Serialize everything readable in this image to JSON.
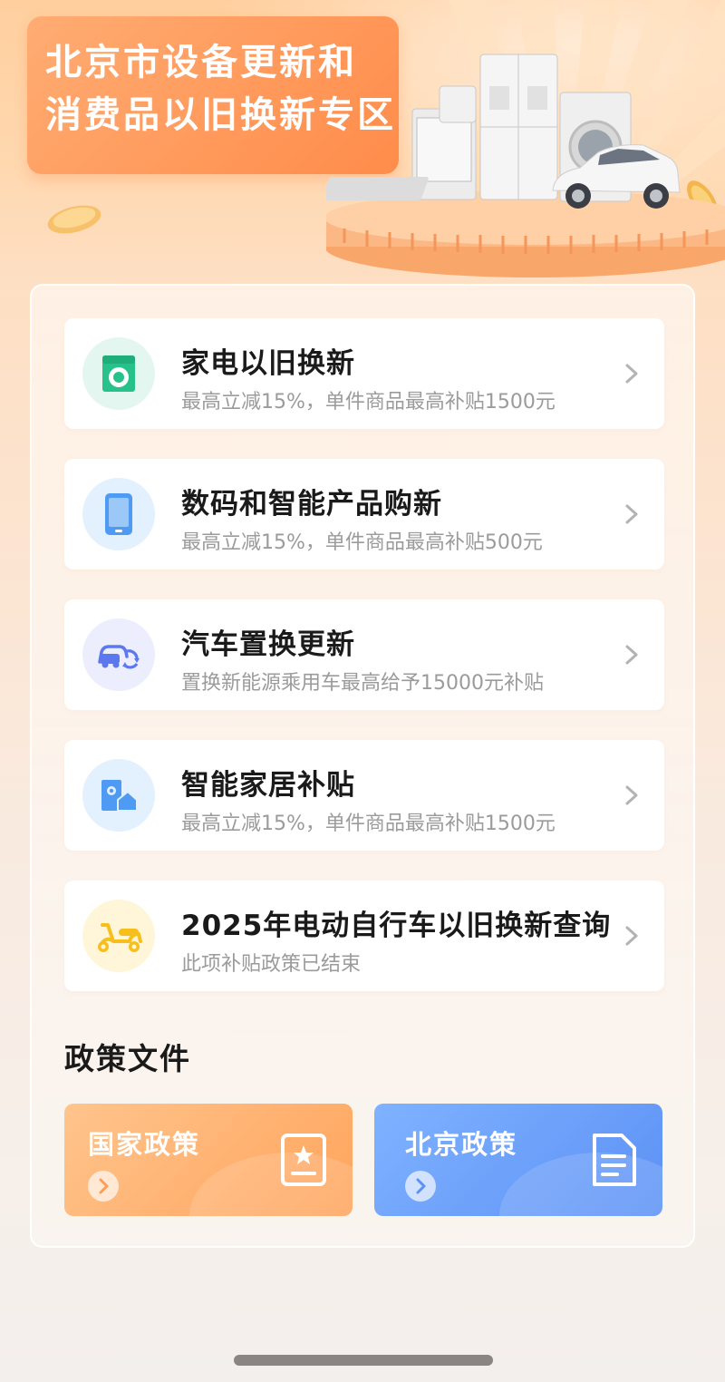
{
  "banner": {
    "title_line1": "北京市设备更新和",
    "title_line2": "消费品以旧换新专区"
  },
  "categories": [
    {
      "title": "家电以旧换新",
      "subtitle": "最高立减15%，单件商品最高补贴1500元",
      "icon": "washing-machine-icon",
      "icon_bg": "#e3f6ef",
      "icon_color": "#27c28a"
    },
    {
      "title": "数码和智能产品购新",
      "subtitle": "最高立减15%，单件商品最高补贴500元",
      "icon": "smartphone-icon",
      "icon_bg": "#e3f0fd",
      "icon_color": "#4f9bf3"
    },
    {
      "title": "汽车置换更新",
      "subtitle": "置换新能源乘用车最高给予15000元补贴",
      "icon": "car-exchange-icon",
      "icon_bg": "#eceefd",
      "icon_color": "#5c78ee"
    },
    {
      "title": "智能家居补贴",
      "subtitle": "最高立减15%，单件商品最高补贴1500元",
      "icon": "smart-home-icon",
      "icon_bg": "#e3f0fd",
      "icon_color": "#4f9bf3"
    },
    {
      "title": "2025年电动自行车以旧换新查询",
      "subtitle": "此项补贴政策已结束",
      "icon": "scooter-icon",
      "icon_bg": "#fff5d9",
      "icon_color": "#f7bf1c"
    }
  ],
  "policy": {
    "section_title": "政策文件",
    "national_label": "国家政策",
    "beijing_label": "北京政策"
  },
  "colors": {
    "accent_orange": "#ff8c4a",
    "accent_blue": "#5c91f5",
    "title_text": "#1a1a1a",
    "subtitle_text": "#9b9b9b"
  }
}
